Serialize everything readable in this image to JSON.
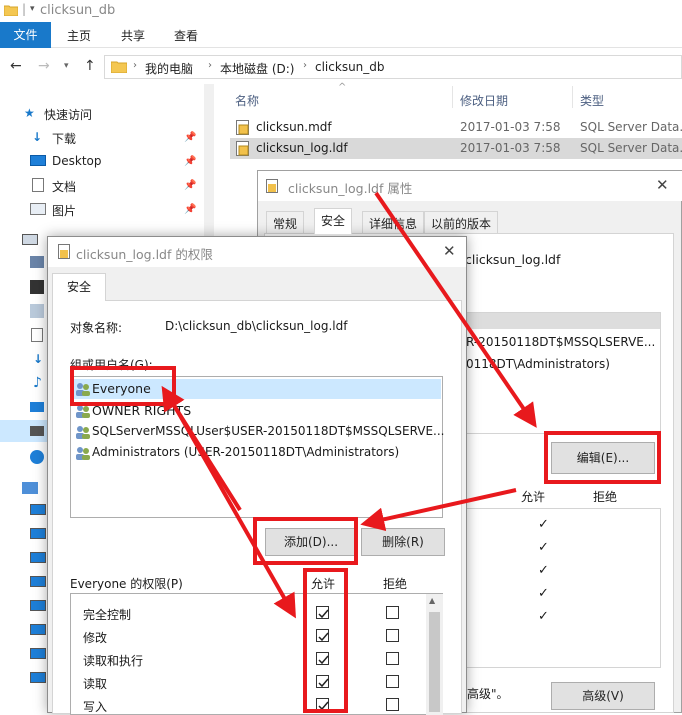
{
  "explorer": {
    "title": "clicksun_db",
    "ribbon_tabs": [
      "文件",
      "主页",
      "共享",
      "查看"
    ],
    "breadcrumb": [
      "我的电脑",
      "本地磁盘 (D:)",
      "clicksun_db"
    ],
    "nav": {
      "quick_access": "快速访问",
      "items": [
        "下载",
        "Desktop",
        "文档",
        "图片"
      ]
    },
    "columns": {
      "name": "名称",
      "modified": "修改日期",
      "type": "类型"
    },
    "files": [
      {
        "name": "clicksun.mdf",
        "date": "2017-01-03 7:58",
        "type": "SQL Server Data..."
      },
      {
        "name": "clicksun_log.ldf",
        "date": "2017-01-03 7:58",
        "type": "SQL Server Data..."
      }
    ]
  },
  "properties": {
    "title": "clicksun_log.ldf 属性",
    "tabs": [
      "常规",
      "安全",
      "详细信息",
      "以前的版本"
    ],
    "object_name": "clicksun_log.ldf",
    "group_partial": [
      "R-20150118DT$MSSQLSERVE...",
      "0118DT\\Administrators)"
    ],
    "edit_button": "编辑(E)...",
    "allow_header": "允许",
    "deny_header": "拒绝",
    "advanced_hint": "高级\"。",
    "advanced_button": "高级(V)"
  },
  "permissions": {
    "title": "clicksun_log.ldf 的权限",
    "tab": "安全",
    "object_label": "对象名称:",
    "object_value": "D:\\clicksun_db\\clicksun_log.ldf",
    "groups_label": "组或用户名(G):",
    "users": [
      "Everyone",
      "OWNER RIGHTS",
      "SQLServerMSSQLUser$USER-20150118DT$MSSQLSERVE...",
      "Administrators (USER-20150118DT\\Administrators)"
    ],
    "add_button": "添加(D)...",
    "remove_button": "删除(R)",
    "perm_label": "Everyone 的权限(P)",
    "allow_header": "允许",
    "deny_header": "拒绝",
    "perms": [
      {
        "name": "完全控制",
        "allow": true,
        "deny": false
      },
      {
        "name": "修改",
        "allow": true,
        "deny": false
      },
      {
        "name": "读取和执行",
        "allow": true,
        "deny": false
      },
      {
        "name": "读取",
        "allow": true,
        "deny": false
      },
      {
        "name": "写入",
        "allow": true,
        "deny": false
      }
    ]
  },
  "colors": {
    "accent": "#1979ca",
    "annotation": "#e8191d",
    "selection": "#cce8ff"
  }
}
